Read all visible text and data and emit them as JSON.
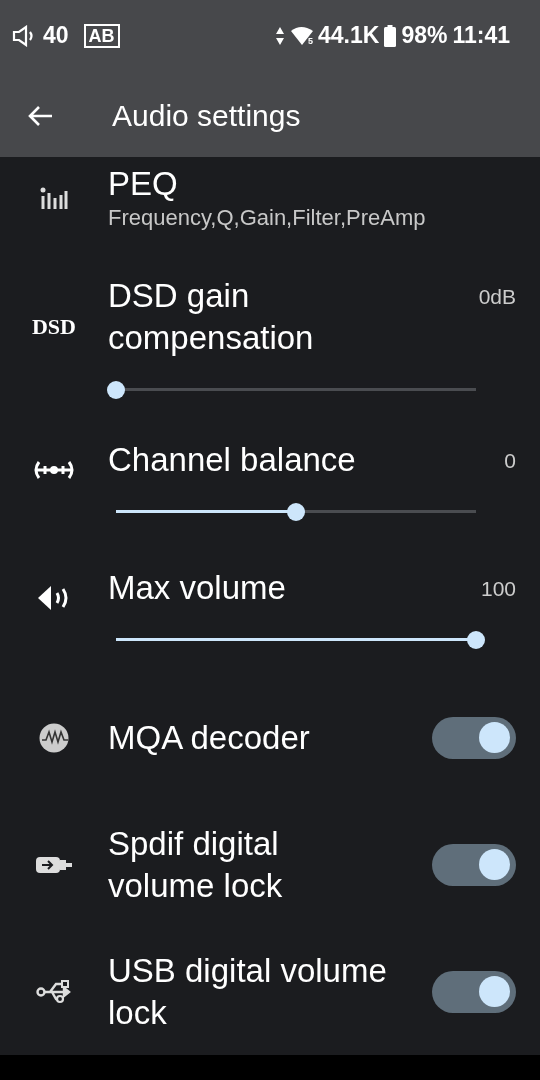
{
  "status_bar": {
    "volume": "40",
    "mode_badge": "AB",
    "wifi_band": "5",
    "sample_rate": "44.1K",
    "battery": "98%",
    "time": "11:41"
  },
  "app_bar": {
    "title": "Audio settings"
  },
  "settings": [
    {
      "kind": "link",
      "title": "PEQ",
      "subtitle": "Frequency,Q,Gain,Filter,PreAmp"
    },
    {
      "kind": "slider",
      "icon_text": "DSD",
      "title": "DSD gain compensation",
      "reading": "0dB",
      "level": 0
    },
    {
      "kind": "slider",
      "title": "Channel balance",
      "reading": "0",
      "level": 0.5
    },
    {
      "kind": "slider",
      "title": "Max volume",
      "reading": "100",
      "level": 1
    },
    {
      "kind": "switch",
      "title": "MQA decoder",
      "on": true
    },
    {
      "kind": "switch",
      "title": "Spdif digital volume lock",
      "on": true
    },
    {
      "kind": "switch",
      "title": "USB digital volume lock",
      "on": true
    }
  ]
}
